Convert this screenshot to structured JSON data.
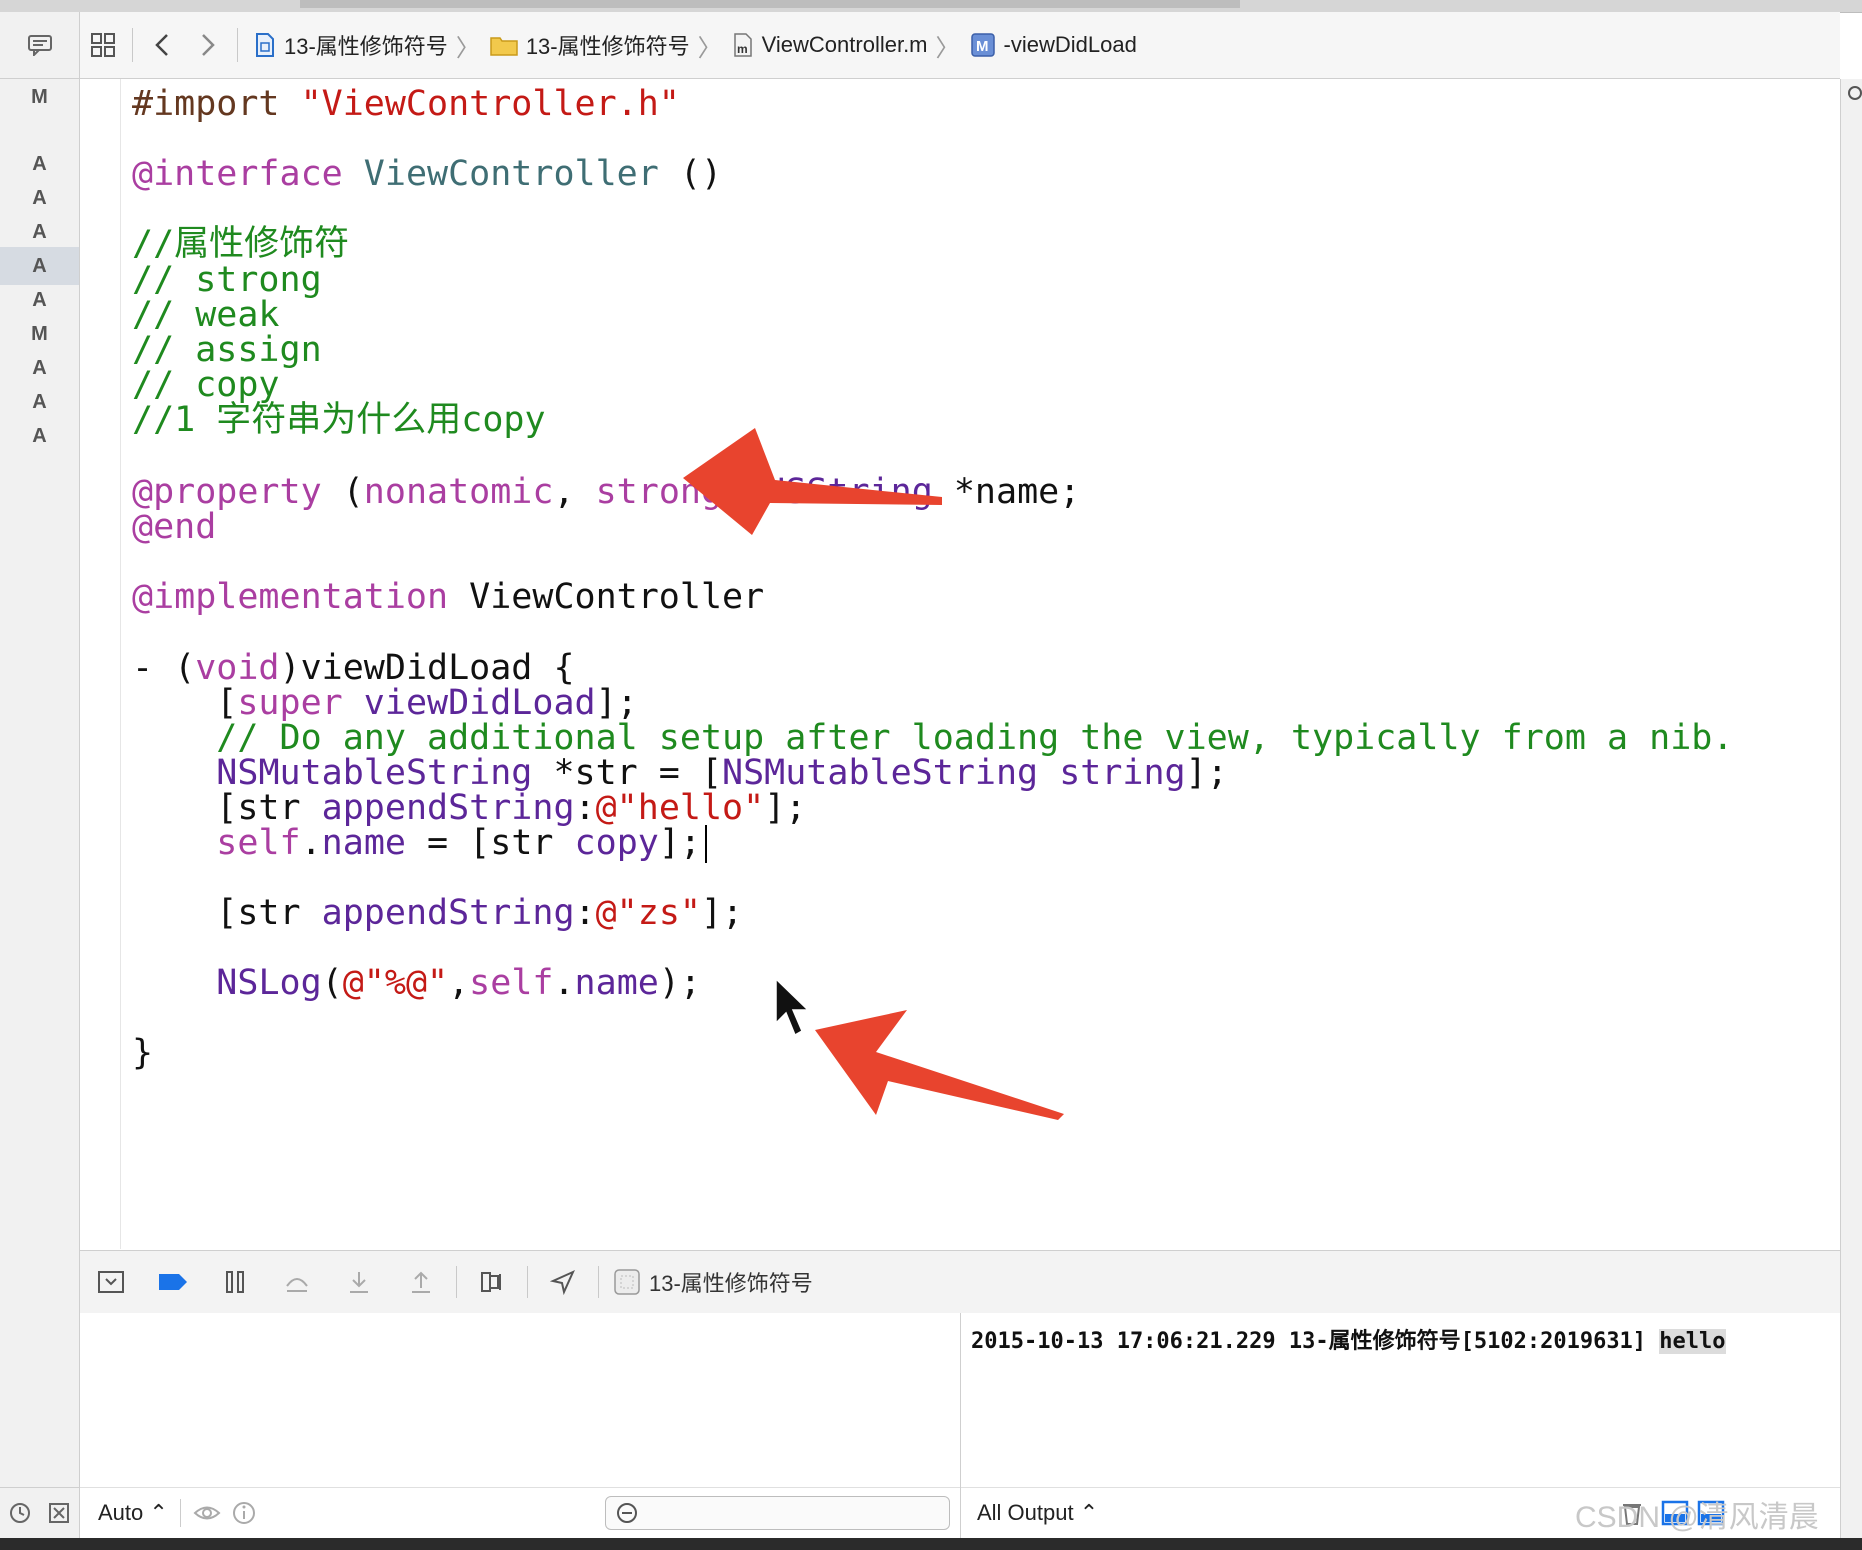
{
  "jumpbar": {
    "crumbs": [
      {
        "label": "13-属性修饰符号",
        "icon": "project-icon"
      },
      {
        "label": "13-属性修饰符号",
        "icon": "folder-icon"
      },
      {
        "label": "ViewController.m",
        "icon": "objc-file-icon"
      },
      {
        "label": "-viewDidLoad",
        "icon": "method-icon"
      }
    ]
  },
  "sidebar": {
    "badges": [
      "M",
      "A",
      "A",
      "A",
      "A",
      "A",
      "M",
      "A",
      "A",
      "A"
    ],
    "selected_index": 4
  },
  "code": {
    "lines": [
      {
        "parts": [
          {
            "t": "#import ",
            "c": "pre"
          },
          {
            "t": "\"ViewController.h\"",
            "c": "str"
          }
        ]
      },
      {
        "parts": []
      },
      {
        "parts": [
          {
            "t": "@interface ",
            "c": "kw"
          },
          {
            "t": "ViewController",
            "c": "cls"
          },
          {
            "t": " ()",
            "c": "plain"
          }
        ]
      },
      {
        "parts": []
      },
      {
        "parts": [
          {
            "t": "//属性修饰符",
            "c": "cm"
          }
        ]
      },
      {
        "parts": [
          {
            "t": "// strong",
            "c": "cm"
          }
        ]
      },
      {
        "parts": [
          {
            "t": "// weak",
            "c": "cm"
          }
        ]
      },
      {
        "parts": [
          {
            "t": "// assign",
            "c": "cm"
          }
        ]
      },
      {
        "parts": [
          {
            "t": "// copy",
            "c": "cm"
          }
        ]
      },
      {
        "parts": [
          {
            "t": "//1 字符串为什么用copy",
            "c": "cm"
          }
        ]
      },
      {
        "parts": []
      },
      {
        "parts": [
          {
            "t": "@property ",
            "c": "kw"
          },
          {
            "t": "(",
            "c": "plain"
          },
          {
            "t": "nonatomic",
            "c": "kw"
          },
          {
            "t": ", ",
            "c": "plain"
          },
          {
            "t": "strong",
            "c": "kw"
          },
          {
            "t": ") ",
            "c": "plain"
          },
          {
            "t": "NSString",
            "c": "type"
          },
          {
            "t": " *name;",
            "c": "plain"
          }
        ]
      },
      {
        "parts": [
          {
            "t": "@end",
            "c": "kw"
          }
        ]
      },
      {
        "parts": []
      },
      {
        "parts": [
          {
            "t": "@implementation ",
            "c": "kw"
          },
          {
            "t": "ViewController",
            "c": "plain"
          }
        ]
      },
      {
        "parts": []
      },
      {
        "parts": [
          {
            "t": "- (",
            "c": "plain"
          },
          {
            "t": "void",
            "c": "kw"
          },
          {
            "t": ")viewDidLoad {",
            "c": "plain"
          }
        ]
      },
      {
        "parts": [
          {
            "t": "    [",
            "c": "plain"
          },
          {
            "t": "super",
            "c": "kw"
          },
          {
            "t": " ",
            "c": "plain"
          },
          {
            "t": "viewDidLoad",
            "c": "type"
          },
          {
            "t": "];",
            "c": "plain"
          }
        ]
      },
      {
        "parts": [
          {
            "t": "    // Do any additional setup after loading the view, typically from a nib.",
            "c": "cm"
          }
        ]
      },
      {
        "parts": [
          {
            "t": "    ",
            "c": "plain"
          },
          {
            "t": "NSMutableString",
            "c": "type"
          },
          {
            "t": " *str = [",
            "c": "plain"
          },
          {
            "t": "NSMutableString",
            "c": "type"
          },
          {
            "t": " ",
            "c": "plain"
          },
          {
            "t": "string",
            "c": "type"
          },
          {
            "t": "];",
            "c": "plain"
          }
        ]
      },
      {
        "parts": [
          {
            "t": "    [str ",
            "c": "plain"
          },
          {
            "t": "appendString",
            "c": "type"
          },
          {
            "t": ":",
            "c": "plain"
          },
          {
            "t": "@\"hello\"",
            "c": "str"
          },
          {
            "t": "];",
            "c": "plain"
          }
        ]
      },
      {
        "parts": [
          {
            "t": "    ",
            "c": "plain"
          },
          {
            "t": "self",
            "c": "kw"
          },
          {
            "t": ".",
            "c": "plain"
          },
          {
            "t": "name",
            "c": "type"
          },
          {
            "t": " = [str ",
            "c": "plain"
          },
          {
            "t": "copy",
            "c": "type"
          },
          {
            "t": "];",
            "c": "plain"
          }
        ],
        "caret": true
      },
      {
        "parts": []
      },
      {
        "parts": [
          {
            "t": "    [str ",
            "c": "plain"
          },
          {
            "t": "appendString",
            "c": "type"
          },
          {
            "t": ":",
            "c": "plain"
          },
          {
            "t": "@\"zs\"",
            "c": "str"
          },
          {
            "t": "];",
            "c": "plain"
          }
        ]
      },
      {
        "parts": []
      },
      {
        "parts": [
          {
            "t": "    ",
            "c": "plain"
          },
          {
            "t": "NSLog",
            "c": "type"
          },
          {
            "t": "(",
            "c": "plain"
          },
          {
            "t": "@\"%@\"",
            "c": "str"
          },
          {
            "t": ",",
            "c": "plain"
          },
          {
            "t": "self",
            "c": "kw"
          },
          {
            "t": ".",
            "c": "plain"
          },
          {
            "t": "name",
            "c": "type"
          },
          {
            "t": ");",
            "c": "plain"
          }
        ]
      },
      {
        "parts": []
      },
      {
        "parts": [
          {
            "t": "}",
            "c": "plain"
          }
        ]
      }
    ]
  },
  "debug": {
    "process_label": "13-属性修饰符号"
  },
  "variables": {
    "scope_label": "Auto ⌃"
  },
  "console": {
    "log_prefix": "2015-10-13 17:06:21.229 13-属性修饰符号[5102:2019631] ",
    "log_value": "hello",
    "output_label": "All Output ⌃"
  },
  "watermark": "CSDN @清风清晨",
  "colors": {
    "keyword": "#aa3ea1",
    "comment": "#1f8a1f",
    "string": "#c41a16",
    "class": "#3f6e74",
    "type": "#5c2699",
    "annotation_arrow": "#e8442e",
    "breakpoint_blue": "#1a73e8"
  }
}
